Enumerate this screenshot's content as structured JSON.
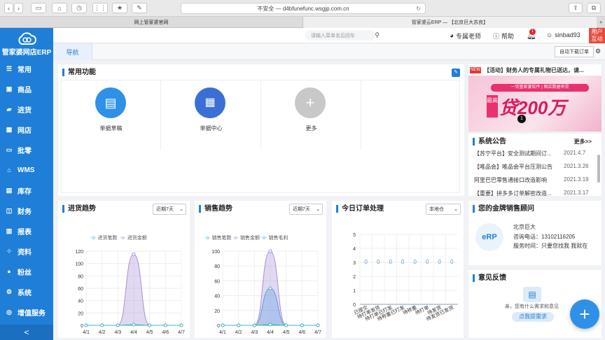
{
  "browser": {
    "url": "不安全 — d4bfunefunc.wsgjp.com.cn",
    "tabs": [
      "网上管家婆官网",
      "管家婆云ERP — 【北京巨大苏良】"
    ]
  },
  "brand": {
    "name": "管家婆网店ERP"
  },
  "sidebar": {
    "items": [
      {
        "label": "常用",
        "icon": "list-icon"
      },
      {
        "label": "商品",
        "icon": "box-icon"
      },
      {
        "label": "进货",
        "icon": "truck-icon"
      },
      {
        "label": "网店",
        "icon": "shop-icon"
      },
      {
        "label": "批零",
        "icon": "monitor-icon"
      },
      {
        "label": "WMS",
        "icon": "warehouse-icon"
      },
      {
        "label": "库存",
        "icon": "inventory-icon"
      },
      {
        "label": "财务",
        "icon": "finance-icon"
      },
      {
        "label": "报表",
        "icon": "report-icon"
      },
      {
        "label": "资料",
        "icon": "grid-icon"
      },
      {
        "label": "粉丝",
        "icon": "fans-icon"
      },
      {
        "label": "系统",
        "icon": "gear-icon"
      },
      {
        "label": "增值服务",
        "icon": "service-icon"
      }
    ],
    "collapse": "<"
  },
  "header": {
    "search_placeholder": "请输入菜单名后回车",
    "advisor": "专属老师",
    "help": "帮助",
    "bell_count": "1",
    "user": "sinbad93",
    "user_interact": "用户互动"
  },
  "nav": {
    "tab": "导航",
    "auto_download": "自动下载订单"
  },
  "common": {
    "title": "常用功能",
    "items": [
      "单据草稿",
      "单据中心",
      "更多"
    ]
  },
  "promo": {
    "tag": "NEW",
    "text": "【活动】财务人的专属礼物已送达，请...",
    "banner_top": "一凭管家婆软件 | 网店数据申贷",
    "banner_left": "最高",
    "banner_main": "贷200万",
    "badge": "1"
  },
  "announcements": {
    "title": "系统公告",
    "more": "更多>>",
    "items": [
      {
        "text": "【苏宁平台】安全测试期间订...",
        "date": "2021.4.7"
      },
      {
        "text": "【唯品会】唯品会平台压测公告",
        "date": "2021.3.26"
      },
      {
        "text": "阿里巴巴零售通接口改造影响",
        "date": "2021.3.19"
      },
      {
        "text": "【重要】拼多多订单解密改造...",
        "date": "2021.3.17"
      }
    ]
  },
  "purchase": {
    "title": "进货趋势",
    "range": "近期7天"
  },
  "sales": {
    "title": "销售趋势",
    "range": "近期7天"
  },
  "orders": {
    "title": "今日订单处理",
    "range": "本地仓"
  },
  "advisor_card": {
    "title": "您的金牌销售顾问",
    "name": "北京巨大",
    "phone": "咨询电话：13102116205",
    "hours": "服务时间：只要您找我 我就在"
  },
  "feedback": {
    "title": "意见反馈",
    "text": "亲，您有什么需求和意见",
    "button": "点我提需求"
  },
  "colors": {
    "brand": "#1f7fd8",
    "series_a": "#3bb7c9",
    "series_b": "#a98fd8",
    "series_c": "#5aa0e0"
  },
  "chart_data": [
    {
      "type": "area",
      "x": [
        "4/1",
        "4/2",
        "4/3",
        "4/4",
        "4/5",
        "4/6",
        "4/7"
      ],
      "ylim": [
        0,
        120
      ],
      "yticks": [
        0,
        20,
        40,
        60,
        80,
        100,
        120
      ],
      "series": [
        {
          "name": "进货笔数",
          "values": [
            0,
            0,
            0,
            1,
            0,
            0,
            0
          ]
        },
        {
          "name": "进货金额",
          "values": [
            0,
            0,
            0,
            115,
            0,
            0,
            0
          ]
        }
      ]
    },
    {
      "type": "area",
      "x": [
        "4/1",
        "4/2",
        "4/3",
        "4/4",
        "4/5",
        "4/6",
        "4/7"
      ],
      "ylim": [
        0,
        100
      ],
      "yticks": [
        0,
        20,
        40,
        60,
        80,
        100
      ],
      "series": [
        {
          "name": "销售笔数",
          "values": [
            0,
            0,
            0,
            1,
            0,
            0,
            0
          ]
        },
        {
          "name": "销售金额",
          "values": [
            0,
            0,
            0,
            100,
            0,
            0,
            0
          ]
        },
        {
          "name": "销售毛利",
          "values": [
            0,
            0,
            0,
            50,
            0,
            0,
            0
          ]
        }
      ]
    },
    {
      "type": "bar",
      "categories": [
        "已提交",
        "待打单发货",
        "待打单已打发",
        "待称重已打发",
        "待称重",
        "待打单",
        "待发货",
        "待发货已发货"
      ],
      "values": [
        0,
        0,
        0,
        0,
        0,
        0,
        0,
        0
      ],
      "ylim": [
        0,
        5
      ],
      "yticks": [
        0,
        1,
        2,
        3,
        4,
        5
      ]
    }
  ]
}
